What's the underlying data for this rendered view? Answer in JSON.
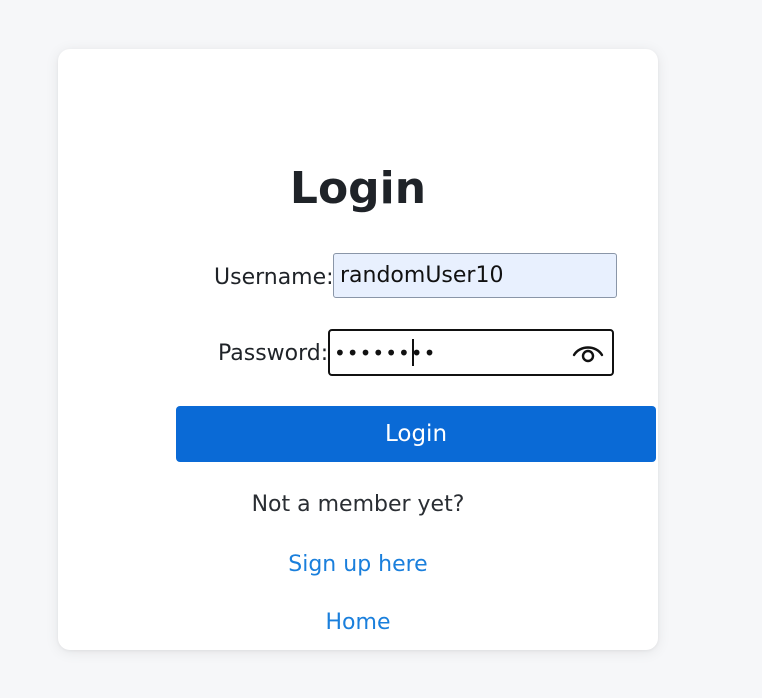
{
  "login_form": {
    "title": "Login",
    "username_label": "Username:",
    "username_value": "randomUser10",
    "password_label": "Password:",
    "password_value": "••••••••",
    "show_password_icon": "eye-icon",
    "submit_label": "Login",
    "not_member_text": "Not a member yet?",
    "signup_link": "Sign up here",
    "home_link": "Home"
  },
  "colors": {
    "page_background": "#f6f7f9",
    "card_background": "#ffffff",
    "button_background": "#0a6ad6",
    "link_color": "#1a7fdc",
    "autofill_background": "#e8f0fe"
  }
}
